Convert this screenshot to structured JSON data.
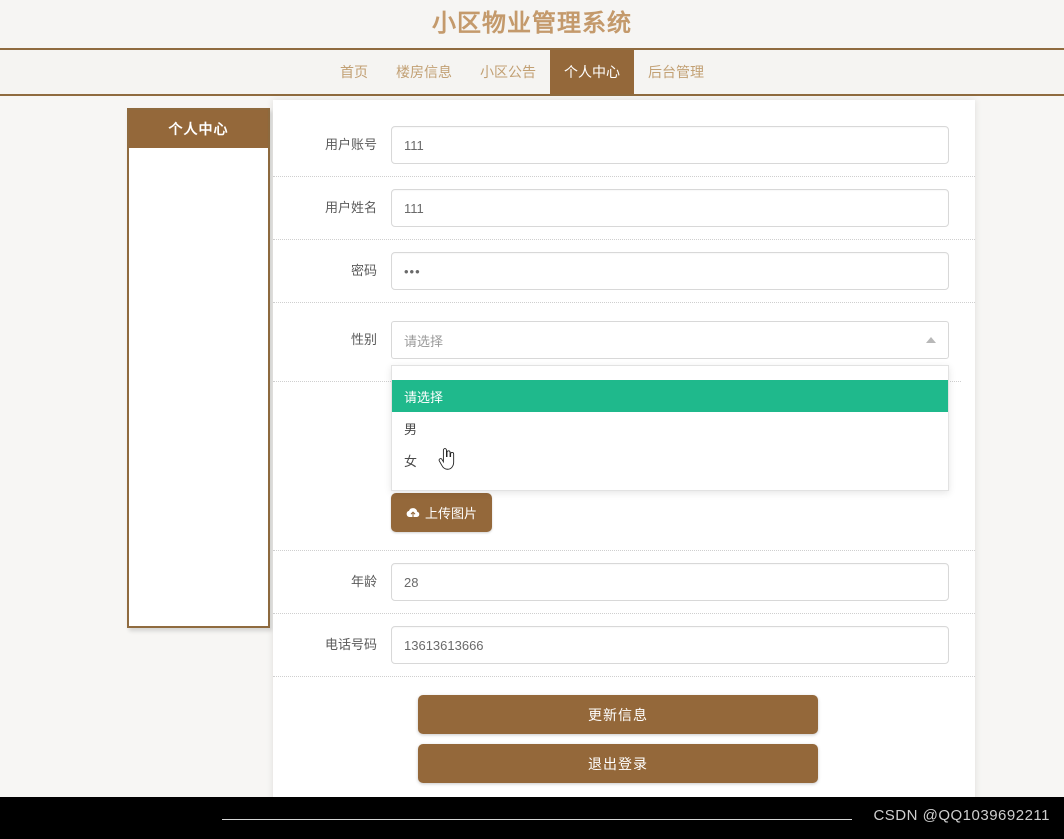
{
  "header": {
    "title": "小区物业管理系统",
    "title_color": "#c49a6c"
  },
  "nav": {
    "items": [
      {
        "label": "首页",
        "active": false
      },
      {
        "label": "楼房信息",
        "active": false
      },
      {
        "label": "小区公告",
        "active": false
      },
      {
        "label": "个人中心",
        "active": true
      },
      {
        "label": "后台管理",
        "active": false
      }
    ],
    "active_bg": "#94683a",
    "link_color": "#c2a074"
  },
  "sidebar": {
    "title": "个人中心",
    "items": []
  },
  "form": {
    "fields": [
      {
        "label": "用户账号",
        "value": "111",
        "type": "text",
        "name": "account"
      },
      {
        "label": "用户姓名",
        "value": "111",
        "type": "text",
        "name": "username"
      },
      {
        "label": "密码",
        "value": "•••",
        "type": "password",
        "name": "password"
      }
    ],
    "gender": {
      "label": "性别",
      "value": "请选择",
      "placeholder": "请选择",
      "open": true,
      "options": [
        {
          "label": "请选择",
          "highlighted": true
        },
        {
          "label": "男",
          "highlighted": false
        },
        {
          "label": "女",
          "highlighted": false
        }
      ],
      "highlight_color": "#1fb98c"
    },
    "upload": {
      "label": "上传图片",
      "icon": "cloud-upload-icon"
    },
    "fields_bottom": [
      {
        "label": "年龄",
        "value": "28",
        "type": "text",
        "name": "age"
      },
      {
        "label": "电话号码",
        "value": "13613613666",
        "type": "text",
        "name": "phone"
      }
    ],
    "actions": [
      {
        "label": "更新信息",
        "name": "update-info"
      },
      {
        "label": "退出登录",
        "name": "logout"
      }
    ],
    "button_color": "#94683a"
  },
  "footer": {
    "watermark": "CSDN @QQ1039692211"
  }
}
